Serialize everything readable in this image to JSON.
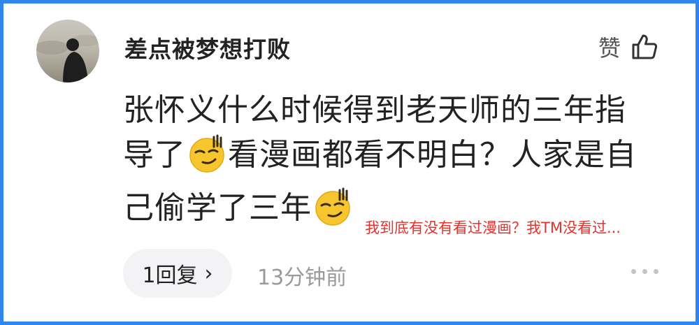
{
  "comment": {
    "username": "差点被梦想打败",
    "like_label": "赞",
    "text_part1": "张怀义什么时候得到老天师的三年指导了",
    "text_part2": "看漫画都看不明白？人家是自己偷学了三年",
    "emoji_names": [
      "smirk-emoji",
      "smirk-emoji"
    ],
    "overlay_note": "我到底有没有看过漫画？我TM没看过...",
    "reply_label": "1回复",
    "reply_chevron": "›",
    "timestamp": "13分钟前",
    "icons": [
      "avatar",
      "thumbs-up-icon",
      "chevron-right-icon",
      "more-dots-icon"
    ]
  },
  "colors": {
    "border": "#2f86ee",
    "text": "#222222",
    "meta": "#9a9a9a",
    "note": "#e5322d",
    "pill_bg": "#f3f3f5"
  }
}
